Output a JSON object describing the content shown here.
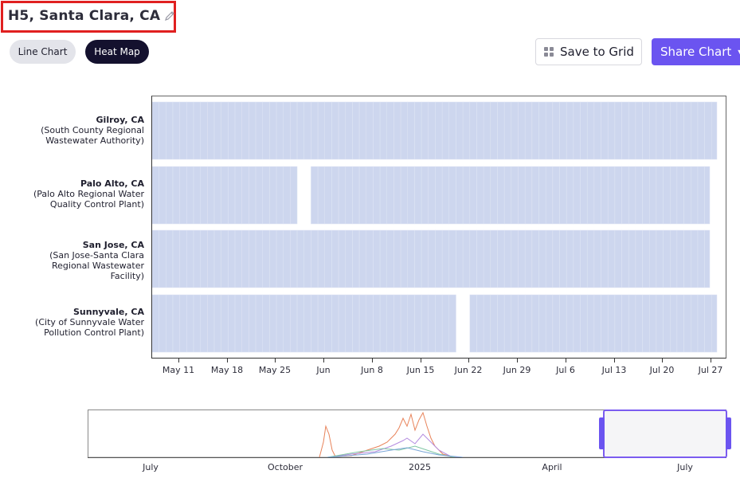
{
  "header": {
    "title": "H5, Santa Clara, CA"
  },
  "tabs": [
    {
      "label": "Line Chart",
      "active": false
    },
    {
      "label": "Heat Map",
      "active": true
    }
  ],
  "toolbar": {
    "save_label": "Save to Grid",
    "share_label": "Share Chart"
  },
  "colors": {
    "accent": "#6b54f0",
    "cell": "#cdd6ee",
    "active_tab": "#14112e"
  },
  "chart_data": {
    "type": "heatmap",
    "rows": [
      {
        "name": "Gilroy, CA",
        "detail": [
          "(South County Regional",
          "Wastewater Authority)"
        ]
      },
      {
        "name": "Palo Alto, CA",
        "detail": [
          "(Palo Alto Regional Water",
          "Quality Control Plant)"
        ]
      },
      {
        "name": "San Jose, CA",
        "detail": [
          "(San Jose-Santa Clara",
          "Regional Wastewater",
          "Facility)"
        ]
      },
      {
        "name": "Sunnyvale, CA",
        "detail": [
          "(City of Sunnyvale Water",
          "Pollution Control Plant)"
        ]
      }
    ],
    "x_ticks": [
      "May 11",
      "May 18",
      "May 25",
      "Jun",
      "Jun 8",
      "Jun 15",
      "Jun 22",
      "Jun 29",
      "Jul 6",
      "Jul 13",
      "Jul 20",
      "Jul 27"
    ],
    "x_range": [
      "May 5",
      "Jul 28"
    ],
    "gaps": [
      {
        "row": "Palo Alto, CA",
        "date": "May 30"
      },
      {
        "row": "Sunnyvale, CA",
        "date": "Jun 21"
      }
    ],
    "grid": false
  },
  "overview": {
    "ticks": [
      "July",
      "October",
      "2025",
      "April",
      "July"
    ],
    "series_colors": [
      "#e8835a",
      "#b48ce0",
      "#7fc6a4",
      "#7aa6d8",
      "#9a9a9a"
    ]
  }
}
